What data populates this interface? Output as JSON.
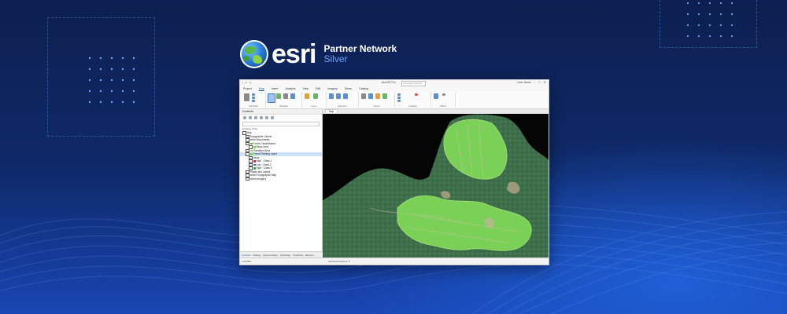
{
  "brand": {
    "wordmark": "esri",
    "program": "Partner Network",
    "tier": "Silver",
    "colors": {
      "background": "#0f2a6a",
      "accent": "#1946b4",
      "tier": "#6fa3ff",
      "polygon_fill": "#7bd158"
    }
  },
  "app": {
    "title": "ArcGIS Pro",
    "search_placeholder": "Command Search",
    "user": "User Name",
    "window_controls": [
      "–",
      "□",
      "✕"
    ],
    "menu": [
      "Project",
      "Map",
      "Insert",
      "Analysis",
      "View",
      "Edit",
      "Imagery",
      "Share",
      "Catalog"
    ],
    "active_menu": "Map",
    "ribbon_groups": [
      "Clipboard",
      "Navigate",
      "Layer",
      "Selection",
      "Inquiry",
      "Labeling",
      "Offline"
    ],
    "contents": {
      "title": "Contents",
      "section": "Drawing Order",
      "layers": [
        {
          "label": "Map",
          "indent": 0,
          "swatch": ""
        },
        {
          "label": "Topographic Labels",
          "indent": 1,
          "swatch": ""
        },
        {
          "label": "World Boundaries",
          "indent": 1,
          "swatch": ""
        },
        {
          "label": "Forest Classification",
          "indent": 1,
          "swatch": "#6aa84f"
        },
        {
          "label": "Study Area",
          "indent": 2,
          "swatch": "#7bd158"
        },
        {
          "label": "Plantation Area",
          "indent": 1,
          "swatch": "#9ccf6b"
        },
        {
          "label": "Forest Planting Layer",
          "indent": 1,
          "swatch": "#7bd158",
          "selected": true
        },
        {
          "label": "Value",
          "indent": 2,
          "swatch": ""
        },
        {
          "label": "High : Class 1",
          "indent": 2,
          "swatch": "#cc3333"
        },
        {
          "label": "Low : Class 2",
          "indent": 2,
          "swatch": "#3366cc"
        },
        {
          "label": "High : Class 3",
          "indent": 2,
          "swatch": "#33a05a"
        },
        {
          "label": "Roads and Labels",
          "indent": 1,
          "swatch": ""
        },
        {
          "label": "World Topographic Map",
          "indent": 1,
          "swatch": ""
        },
        {
          "label": "World Imagery",
          "indent": 1,
          "swatch": ""
        }
      ],
      "bottom_tabs": [
        "Contents",
        "Catalog",
        "Geoprocessing",
        "Symbology",
        "Properties",
        "Element"
      ]
    },
    "map_view": {
      "tab_label": "Map",
      "status_scale": "1:24,000",
      "status_mode": "Selected Features: 0"
    }
  }
}
